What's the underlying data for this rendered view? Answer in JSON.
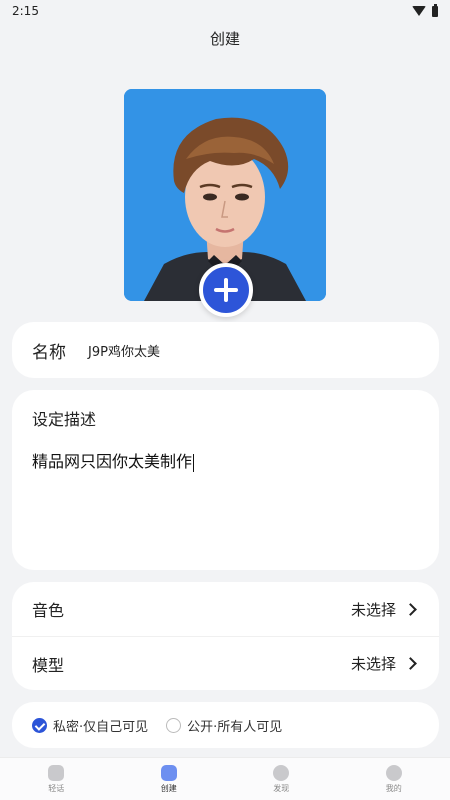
{
  "status_bar": {
    "time": "2:15"
  },
  "header": {
    "title": "创建"
  },
  "avatar": {
    "alt": "角色头像"
  },
  "name": {
    "label": "名称",
    "value": "J9P鸡你太美"
  },
  "description": {
    "label": "设定描述",
    "value": "精品网只因你太美制作"
  },
  "options": [
    {
      "label": "音色",
      "value": "未选择"
    },
    {
      "label": "模型",
      "value": "未选择"
    }
  ],
  "privacy": {
    "private_label": "私密·仅自己可见",
    "public_label": "公开·所有人可见",
    "selected": "private"
  },
  "tabs": [
    {
      "label": "轻话",
      "icon": "chat-icon"
    },
    {
      "label": "创建",
      "icon": "create-icon",
      "active": true
    },
    {
      "label": "发现",
      "icon": "discover-icon"
    },
    {
      "label": "我的",
      "icon": "profile-icon"
    }
  ],
  "colors": {
    "accent": "#2d55d8",
    "background": "#f2f3f5"
  }
}
